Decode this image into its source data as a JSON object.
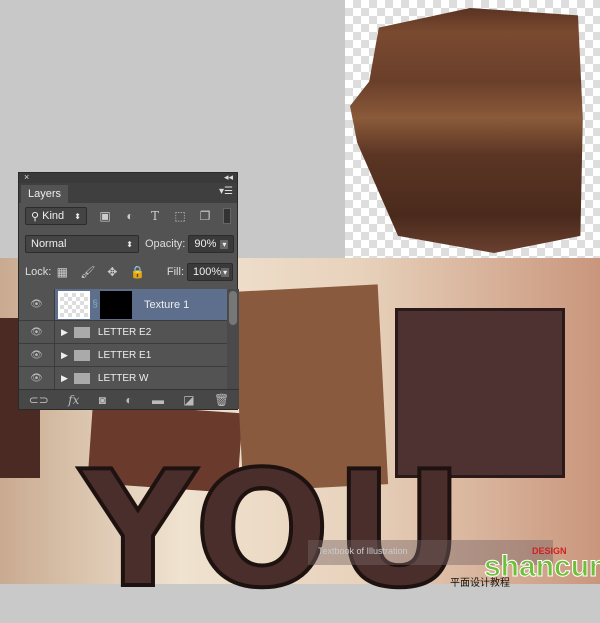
{
  "panel": {
    "close": "×",
    "collapse": "◂◂",
    "tab": "Layers",
    "menu_icon": "menu-icon",
    "filter": {
      "label": "Kind",
      "icons": [
        "image-filter-icon",
        "adjustment-filter-icon",
        "type-filter-icon",
        "shape-filter-icon",
        "smart-object-filter-icon"
      ]
    },
    "blend_mode": "Normal",
    "opacity_label": "Opacity:",
    "opacity": "90%",
    "lock_label": "Lock:",
    "fill_label": "Fill:",
    "fill": "100%",
    "layers": [
      {
        "name": "Texture 1",
        "selected": true,
        "visible": true,
        "type": "masked-layer"
      },
      {
        "name": "LETTER E2",
        "visible": true,
        "type": "group"
      },
      {
        "name": "LETTER E1",
        "visible": true,
        "type": "group"
      },
      {
        "name": "LETTER W",
        "visible": true,
        "type": "group"
      }
    ],
    "bottom_icons": [
      "link-icon",
      "fx-icon",
      "mask-icon",
      "adjustment-icon",
      "group-icon",
      "new-layer-icon",
      "trash-icon"
    ]
  },
  "canvas": {
    "letters": "YOU"
  },
  "watermark": {
    "bar_text": "Textbook of Illustration",
    "logo": "shancun",
    "sub": "平面设计教程",
    "red": "DESIGN"
  },
  "colors": {
    "panel": "#535353",
    "selected_layer": "#5d6f8c",
    "cake": "#6a3f2a",
    "letter": "#4a2e2c"
  }
}
